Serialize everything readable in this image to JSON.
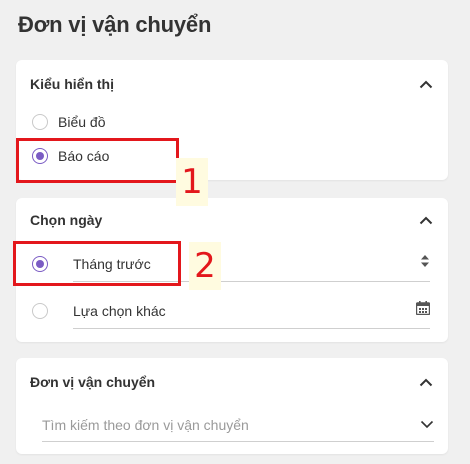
{
  "page": {
    "title": "Đơn vị vận chuyển"
  },
  "display_section": {
    "title": "Kiểu hiển thị",
    "options": [
      {
        "label": "Biểu đồ",
        "checked": false
      },
      {
        "label": "Báo cáo",
        "checked": true
      }
    ]
  },
  "date_section": {
    "title": "Chọn ngày",
    "options": [
      {
        "label": "Tháng trước",
        "checked": true,
        "control": "sort-arrows-icon"
      },
      {
        "label": "Lựa chọn khác",
        "checked": false,
        "control": "calendar-icon"
      }
    ]
  },
  "carrier_section": {
    "title": "Đơn vị vận chuyển",
    "search_placeholder": "Tìm kiếm theo đơn vị vận chuyển"
  },
  "annotations": [
    {
      "number": "1",
      "color": "#e3171c"
    },
    {
      "number": "2",
      "color": "#e3171c"
    }
  ],
  "colors": {
    "accent": "#7b5cc4",
    "annotation": "#e3171c",
    "background": "#f0f0f0"
  }
}
